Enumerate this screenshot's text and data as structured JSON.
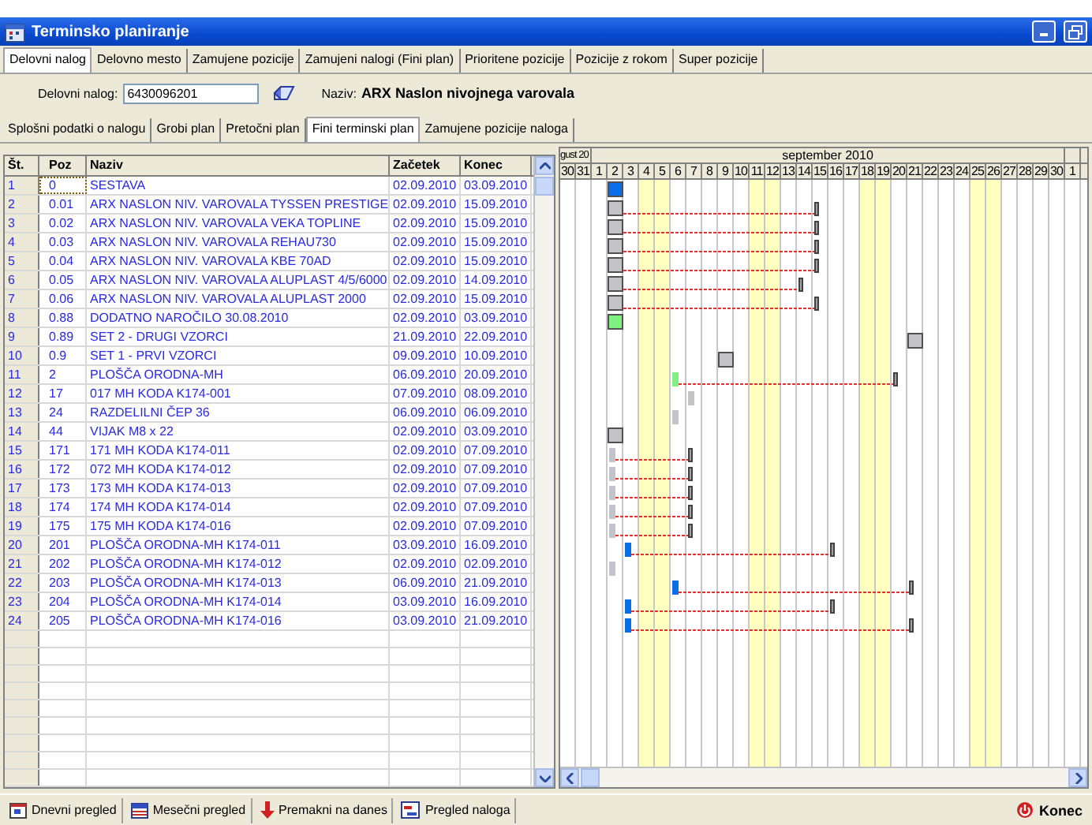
{
  "window": {
    "title": "Terminsko planiranje"
  },
  "tabs": [
    {
      "label": "Delovni nalog",
      "selected": true
    },
    {
      "label": "Delovno mesto",
      "selected": false
    },
    {
      "label": "Zamujene pozicije",
      "selected": false
    },
    {
      "label": "Zamujeni nalogi (Fini plan)",
      "selected": false
    },
    {
      "label": "Prioritene pozicije",
      "selected": false
    },
    {
      "label": "Pozicije z rokom",
      "selected": false
    },
    {
      "label": "Super pozicije",
      "selected": false
    }
  ],
  "order": {
    "label": "Delovni nalog:",
    "value": "6430096201",
    "name_label": "Naziv:",
    "name_value": "ARX Naslon nivojnega varovala"
  },
  "subtabs": [
    {
      "label": "Splošni podatki o nalogu",
      "selected": false
    },
    {
      "label": "Grobi plan",
      "selected": false
    },
    {
      "label": "Pretočni plan",
      "selected": false
    },
    {
      "label": "Fini terminski plan",
      "selected": true
    },
    {
      "label": "Zamujene pozicije naloga",
      "selected": false
    }
  ],
  "table": {
    "columns": [
      "Št.",
      "Poz",
      "Naziv",
      "Začetek",
      "Konec"
    ],
    "rows": [
      {
        "n": "1",
        "poz": "0",
        "naziv": "SESTAVA",
        "start": "02.09.2010",
        "end": "03.09.2010",
        "selected": true,
        "kind": "box",
        "color": "#0a6ee6"
      },
      {
        "n": "2",
        "poz": "0.01",
        "naziv": "ARX NASLON NIV. VAROVALA TYSSEN PRESTIGE",
        "start": "02.09.2010",
        "end": "15.09.2010",
        "selected": false,
        "kind": "box",
        "color": "#c4c4c8"
      },
      {
        "n": "3",
        "poz": "0.02",
        "naziv": "ARX NASLON NIV. VAROVALA VEKA TOPLINE",
        "start": "02.09.2010",
        "end": "15.09.2010",
        "selected": false,
        "kind": "box",
        "color": "#c4c4c8"
      },
      {
        "n": "4",
        "poz": "0.03",
        "naziv": "ARX NASLON NIV. VAROVALA REHAU730",
        "start": "02.09.2010",
        "end": "15.09.2010",
        "selected": false,
        "kind": "box",
        "color": "#c4c4c8"
      },
      {
        "n": "5",
        "poz": "0.04",
        "naziv": "ARX NASLON NIV. VAROVALA KBE 70AD",
        "start": "02.09.2010",
        "end": "15.09.2010",
        "selected": false,
        "kind": "box",
        "color": "#c4c4c8"
      },
      {
        "n": "6",
        "poz": "0.05",
        "naziv": "ARX NASLON NIV. VAROVALA ALUPLAST 4/5/6000",
        "start": "02.09.2010",
        "end": "14.09.2010",
        "selected": false,
        "kind": "box",
        "color": "#c4c4c8"
      },
      {
        "n": "7",
        "poz": "0.06",
        "naziv": "ARX NASLON NIV. VAROVALA ALUPLAST 2000",
        "start": "02.09.2010",
        "end": "15.09.2010",
        "selected": false,
        "kind": "box",
        "color": "#c4c4c8"
      },
      {
        "n": "8",
        "poz": "0.88",
        "naziv": "DODATNO NAROČILO 30.08.2010",
        "start": "02.09.2010",
        "end": "03.09.2010",
        "selected": false,
        "kind": "box",
        "color": "#80f080"
      },
      {
        "n": "9",
        "poz": "0.89",
        "naziv": "SET 2 - DRUGI VZORCI",
        "start": "21.09.2010",
        "end": "22.09.2010",
        "selected": false,
        "kind": "box",
        "color": "#c4c4c8"
      },
      {
        "n": "10",
        "poz": "0.9",
        "naziv": "SET 1 - PRVI VZORCI",
        "start": "09.09.2010",
        "end": "10.09.2010",
        "selected": false,
        "kind": "box",
        "color": "#c4c4c8"
      },
      {
        "n": "11",
        "poz": "2",
        "naziv": "PLOŠČA ORODNA-MH",
        "start": "06.09.2010",
        "end": "20.09.2010",
        "selected": false,
        "kind": "marks",
        "color": "#80f080"
      },
      {
        "n": "12",
        "poz": "17",
        "naziv": "017 MH KODA K174-001",
        "start": "07.09.2010",
        "end": "08.09.2010",
        "selected": false,
        "kind": "marks",
        "color": "#c4c4c8"
      },
      {
        "n": "13",
        "poz": "24",
        "naziv": "RAZDELILNI ČEP 36",
        "start": "06.09.2010",
        "end": "06.09.2010",
        "selected": false,
        "kind": "marks",
        "color": "#c4c4c8"
      },
      {
        "n": "14",
        "poz": "44",
        "naziv": "VIJAK M8 x 22",
        "start": "02.09.2010",
        "end": "03.09.2010",
        "selected": false,
        "kind": "box",
        "color": "#c4c4c8"
      },
      {
        "n": "15",
        "poz": "171",
        "naziv": "171 MH KODA K174-011",
        "start": "02.09.2010",
        "end": "07.09.2010",
        "selected": false,
        "kind": "marks",
        "color": "#c4c4c8"
      },
      {
        "n": "16",
        "poz": "172",
        "naziv": "072 MH KODA K174-012",
        "start": "02.09.2010",
        "end": "07.09.2010",
        "selected": false,
        "kind": "marks",
        "color": "#c4c4c8"
      },
      {
        "n": "17",
        "poz": "173",
        "naziv": "173 MH KODA K174-013",
        "start": "02.09.2010",
        "end": "07.09.2010",
        "selected": false,
        "kind": "marks",
        "color": "#c4c4c8"
      },
      {
        "n": "18",
        "poz": "174",
        "naziv": "174 MH KODA K174-014",
        "start": "02.09.2010",
        "end": "07.09.2010",
        "selected": false,
        "kind": "marks",
        "color": "#c4c4c8"
      },
      {
        "n": "19",
        "poz": "175",
        "naziv": "175 MH KODA K174-016",
        "start": "02.09.2010",
        "end": "07.09.2010",
        "selected": false,
        "kind": "marks",
        "color": "#c4c4c8"
      },
      {
        "n": "20",
        "poz": "201",
        "naziv": "PLOŠČA ORODNA-MH K174-011",
        "start": "03.09.2010",
        "end": "16.09.2010",
        "selected": false,
        "kind": "marks",
        "color": "#0a6ee6"
      },
      {
        "n": "21",
        "poz": "202",
        "naziv": "PLOŠČA ORODNA-MH K174-012",
        "start": "02.09.2010",
        "end": "02.09.2010",
        "selected": false,
        "kind": "marks",
        "color": "#c4c4c8"
      },
      {
        "n": "22",
        "poz": "203",
        "naziv": "PLOŠČA ORODNA-MH K174-013",
        "start": "06.09.2010",
        "end": "21.09.2010",
        "selected": false,
        "kind": "marks",
        "color": "#0a6ee6"
      },
      {
        "n": "23",
        "poz": "204",
        "naziv": "PLOŠČA ORODNA-MH K174-014",
        "start": "03.09.2010",
        "end": "16.09.2010",
        "selected": false,
        "kind": "marks",
        "color": "#0a6ee6"
      },
      {
        "n": "24",
        "poz": "205",
        "naziv": "PLOŠČA ORODNA-MH K174-016",
        "start": "03.09.2010",
        "end": "21.09.2010",
        "selected": false,
        "kind": "marks",
        "color": "#0a6ee6"
      }
    ]
  },
  "gantt": {
    "months": [
      {
        "label": "gust 20",
        "days": [
          {
            "label": "30",
            "weekend": false
          },
          {
            "label": "31",
            "weekend": false
          }
        ]
      },
      {
        "label": "september 2010",
        "days": [
          {
            "label": "1",
            "weekend": false
          },
          {
            "label": "2",
            "weekend": false
          },
          {
            "label": "3",
            "weekend": false
          },
          {
            "label": "4",
            "weekend": true
          },
          {
            "label": "5",
            "weekend": true
          },
          {
            "label": "6",
            "weekend": false
          },
          {
            "label": "7",
            "weekend": false
          },
          {
            "label": "8",
            "weekend": false
          },
          {
            "label": "9",
            "weekend": false
          },
          {
            "label": "10",
            "weekend": false
          },
          {
            "label": "11",
            "weekend": true
          },
          {
            "label": "12",
            "weekend": true
          },
          {
            "label": "13",
            "weekend": false
          },
          {
            "label": "14",
            "weekend": false
          },
          {
            "label": "15",
            "weekend": false
          },
          {
            "label": "16",
            "weekend": false
          },
          {
            "label": "17",
            "weekend": false
          },
          {
            "label": "18",
            "weekend": true
          },
          {
            "label": "19",
            "weekend": true
          },
          {
            "label": "20",
            "weekend": false
          },
          {
            "label": "21",
            "weekend": false
          },
          {
            "label": "22",
            "weekend": false
          },
          {
            "label": "23",
            "weekend": false
          },
          {
            "label": "24",
            "weekend": false
          },
          {
            "label": "25",
            "weekend": true
          },
          {
            "label": "26",
            "weekend": true
          },
          {
            "label": "27",
            "weekend": false
          },
          {
            "label": "28",
            "weekend": false
          },
          {
            "label": "29",
            "weekend": false
          },
          {
            "label": "30",
            "weekend": false
          }
        ]
      },
      {
        "days": [
          {
            "label": "1",
            "weekend": false
          }
        ]
      }
    ]
  },
  "toolbar": [
    {
      "label": "Dnevni pregled",
      "kind": "day"
    },
    {
      "label": "Mesečni pregled",
      "kind": "month"
    },
    {
      "label": "Premakni na danes",
      "kind": "today"
    },
    {
      "label": "Pregled naloga",
      "kind": "order"
    }
  ],
  "exit": {
    "label": "Konec"
  }
}
